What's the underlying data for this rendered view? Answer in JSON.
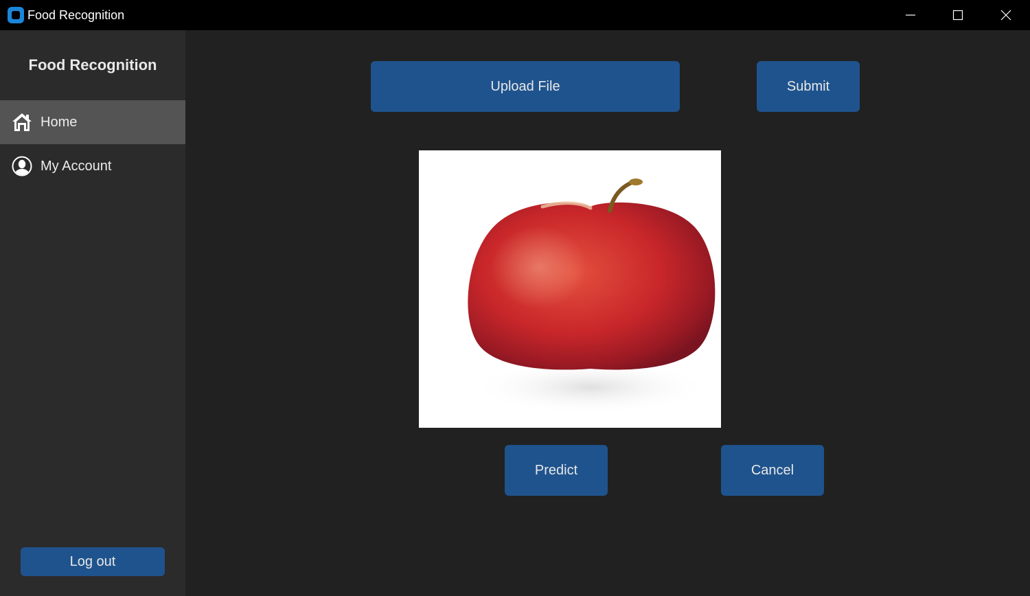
{
  "window": {
    "title": "Food Recognition",
    "controls": {
      "minimize": "minimize-icon",
      "maximize": "maximize-icon",
      "close": "close-icon"
    }
  },
  "sidebar": {
    "title": "Food Recognition",
    "items": [
      {
        "label": "Home",
        "icon": "home-icon",
        "active": true
      },
      {
        "label": "My Account",
        "icon": "user-icon",
        "active": false
      }
    ],
    "logout_label": "Log out"
  },
  "main": {
    "upload_label": "Upload File",
    "submit_label": "Submit",
    "preview_image": "apple-image",
    "predict_label": "Predict",
    "cancel_label": "Cancel"
  },
  "colors": {
    "button": "#1f538d",
    "sidebar_bg": "#2b2b2b",
    "main_bg": "#212121",
    "active_item": "#545454",
    "titlebar": "#000000"
  }
}
